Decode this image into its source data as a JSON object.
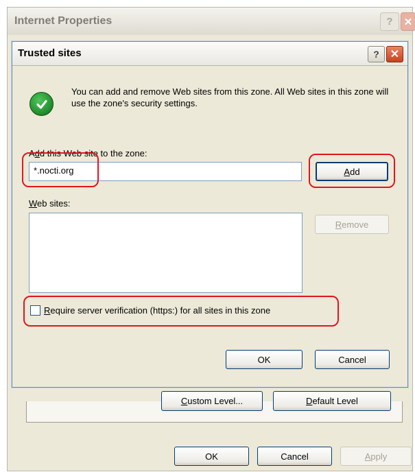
{
  "background_window": {
    "title": "Internet Properties",
    "help_glyph": "?",
    "close_glyph": "✕",
    "custom_level_pre": "",
    "custom_level_accel": "C",
    "custom_level_post": "ustom Level...",
    "default_level_pre": "",
    "default_level_accel": "D",
    "default_level_post": "efault Level",
    "ok_label": "OK",
    "cancel_label": "Cancel",
    "apply_pre": "",
    "apply_accel": "A",
    "apply_post": "pply"
  },
  "dialog": {
    "title": "Trusted sites",
    "help_glyph": "?",
    "close_glyph": "✕",
    "info_text": "You can add and remove Web sites from this zone. All Web sites in this zone will use the zone's security settings.",
    "add_label_pre": "A",
    "add_label_accel": "d",
    "add_label_post": "d this Web site to the zone:",
    "site_input_value": "*.nocti.org",
    "add_button_pre": "",
    "add_button_accel": "A",
    "add_button_post": "dd",
    "websites_label_pre": "",
    "websites_label_accel": "W",
    "websites_label_post": "eb sites:",
    "websites_list": [],
    "remove_button_pre": "",
    "remove_button_accel": "R",
    "remove_button_post": "emove",
    "require_https_checked": false,
    "require_https_label_pre": "",
    "require_https_label_accel": "R",
    "require_https_label_post": "equire server verification (https:) for all sites in this zone",
    "ok_label": "OK",
    "cancel_label": "Cancel"
  },
  "icons": {
    "info_check": "check-circle-icon",
    "help": "help-icon",
    "close": "close-icon"
  },
  "colors": {
    "dialog_face": "#ece9d8",
    "highlight": "#e3141c",
    "check_green": "#1f8a2b",
    "close_red": "#c9411c"
  }
}
